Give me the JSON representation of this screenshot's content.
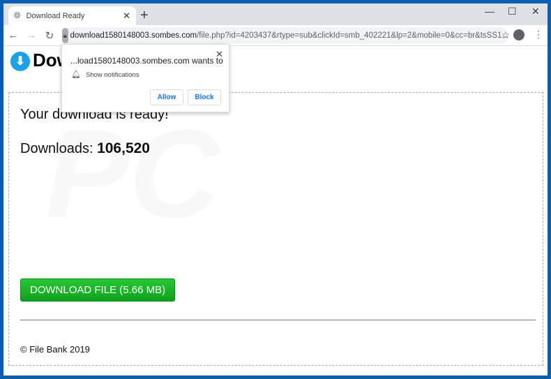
{
  "browser": {
    "tab_title": "Download Ready",
    "url_host": "download1580148003.sombes.com",
    "url_path": "/file.php?id=4203437&rtype=sub&clickId=smb_402221&lp=2&mobile=0&cc=br&tsSS1..."
  },
  "page": {
    "heading": "Download",
    "ready": "Your download is ready!",
    "downloads_label": "Downloads:",
    "downloads_count": "106,520",
    "button": "DOWNLOAD FILE (5.66 MB)",
    "footer": "© File Bank 2019",
    "watermark": "PC risk.com"
  },
  "popup": {
    "origin": "...load1580148003.sombes.com wants to",
    "permission": "Show notifications",
    "allow": "Allow",
    "block": "Block"
  }
}
